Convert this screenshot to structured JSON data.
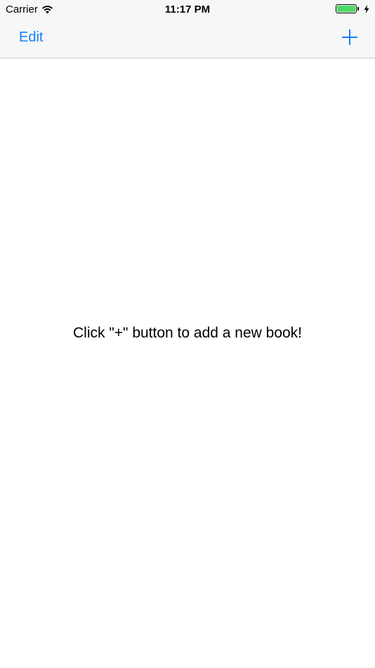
{
  "status_bar": {
    "carrier": "Carrier",
    "time": "11:17 PM",
    "wifi_icon": "wifi-icon",
    "battery_icon": "battery-full-icon",
    "charging_icon": "charging-bolt-icon",
    "battery_color": "#4cd964"
  },
  "nav_bar": {
    "edit_label": "Edit",
    "add_icon": "plus-icon",
    "tint_color": "#147efb"
  },
  "main": {
    "empty_message": "Click \"+\" button to add a new book!"
  }
}
